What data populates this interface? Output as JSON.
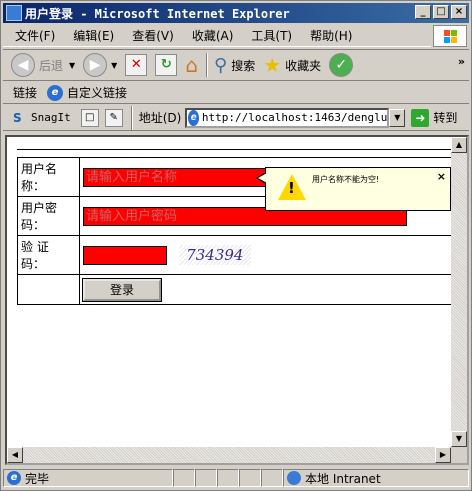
{
  "window": {
    "title": "用户登录 - Microsoft Internet Explorer",
    "minimize": "_",
    "maximize": "□",
    "close": "×"
  },
  "menu": [
    "文件(F)",
    "编辑(E)",
    "查看(V)",
    "收藏(A)",
    "工具(T)",
    "帮助(H)"
  ],
  "toolbar": {
    "back": "后退",
    "search": "搜索",
    "favorites": "收藏夹",
    "more": "»"
  },
  "links": {
    "label": "链接",
    "custom": "自定义链接"
  },
  "address": {
    "snagit": "SnagIt",
    "label": "地址(D)",
    "url": "http://localhost:1463/denglu",
    "go": "转到"
  },
  "form": {
    "username_label": "用户名称：",
    "username_placeholder": "请输入用户名称",
    "password_label": "用户密码：",
    "password_placeholder": "请输入用户密码",
    "captcha_label": "验 证 码：",
    "captcha_value": "734394",
    "submit": "登录"
  },
  "tooltip": {
    "message": "用户名称不能为空!",
    "close": "×"
  },
  "status": {
    "text": "完毕",
    "zone": "本地 Intranet"
  },
  "colors": {
    "titlebar": "#0a246a",
    "field_error": "#ff0000",
    "tooltip_bg": "#ffffe1"
  }
}
